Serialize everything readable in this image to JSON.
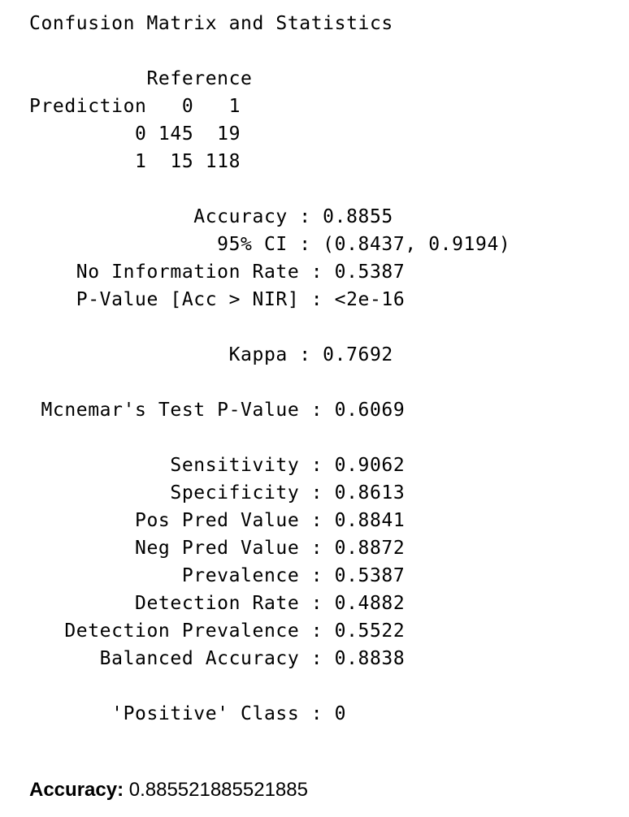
{
  "output": {
    "title": "Confusion Matrix and Statistics",
    "matrix": {
      "reference_header": "          Reference",
      "prediction_header": "Prediction   0   1",
      "row0": "         0 145  19",
      "row1": "         1  15 118"
    },
    "stats": {
      "accuracy": "              Accuracy : 0.8855",
      "ci": "                95% CI : (0.8437, 0.9194)",
      "nir": "    No Information Rate : 0.5387",
      "pvalue": "    P-Value [Acc > NIR] : <2e-16",
      "kappa": "                 Kappa : 0.7692",
      "mcnemar": " Mcnemar's Test P-Value : 0.6069",
      "sensitivity": "            Sensitivity : 0.9062",
      "specificity": "            Specificity : 0.8613",
      "ppv": "         Pos Pred Value : 0.8841",
      "npv": "         Neg Pred Value : 0.8872",
      "prevalence": "             Prevalence : 0.5387",
      "detection_rate": "         Detection Rate : 0.4882",
      "detection_prevalence": "   Detection Prevalence : 0.5522",
      "balanced_accuracy": "      Balanced Accuracy : 0.8838",
      "positive_class": "       'Positive' Class : 0"
    }
  },
  "footer": {
    "label": "Accuracy:",
    "value": " 0.885521885521885"
  }
}
